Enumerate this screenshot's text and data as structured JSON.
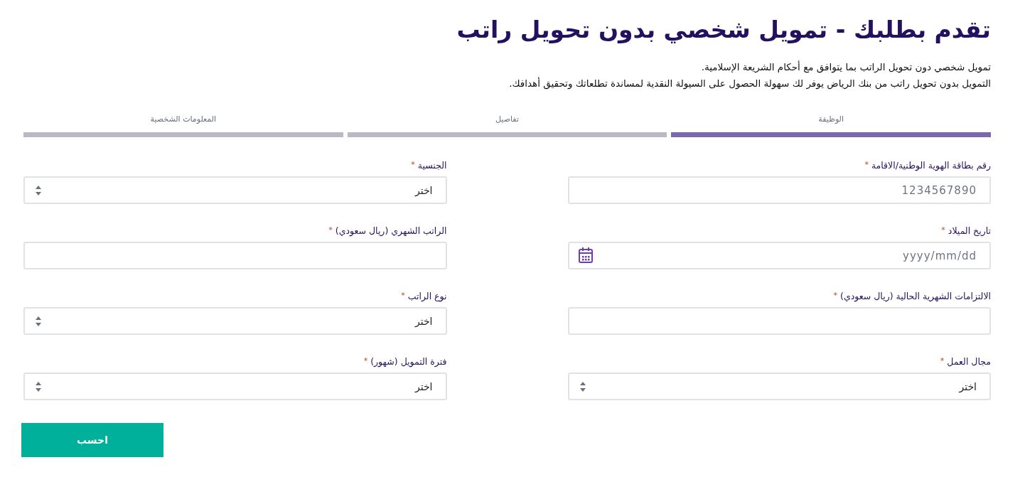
{
  "title": "تقدم بطلبك - تمويل شخصي بدون تحويل راتب",
  "intro": [
    "تمويل شخصي دون تحويل الراتب بما يتوافق مع أحكام الشريعة الإسلامية.",
    "التمويل بدون تحويل راتب من بنك الرياض يوفر لك سهولة الحصول على السيولة النقدية لمساندة تطلعاتك وتحقيق أهدافك."
  ],
  "steps": [
    {
      "label": "الوظيفة",
      "selected": true
    },
    {
      "label": "تفاصيل",
      "selected": false
    },
    {
      "label": "المعلومات الشخصية",
      "selected": false
    }
  ],
  "fields": [
    {
      "kind": "text",
      "label": "رقم بطاقة الهوية الوطنية/الاقامة",
      "required_mark": "*",
      "placeholder": "1234567890"
    },
    {
      "kind": "select",
      "label": "الجنسية",
      "required_mark": "*",
      "value": "اختر"
    },
    {
      "kind": "date",
      "label": "تاريخ الميلاد",
      "required_mark": "*",
      "placeholder": "yyyy/mm/dd"
    },
    {
      "kind": "text",
      "label": "الراتب الشهري (ريال سعودي)",
      "required_mark": "*"
    },
    {
      "kind": "text",
      "label": "الالتزامات الشهرية الحالية (ريال سعودي)",
      "required_mark": "*"
    },
    {
      "kind": "select",
      "label": "نوع الراتب",
      "required_mark": "*",
      "value": "اختر"
    },
    {
      "kind": "select",
      "label": "مجال العمل",
      "required_mark": "*",
      "value": "اختر"
    },
    {
      "kind": "select",
      "label": "فترة التمويل (شهور)",
      "required_mark": "*",
      "value": "اختر"
    }
  ],
  "submit": "احسب"
}
